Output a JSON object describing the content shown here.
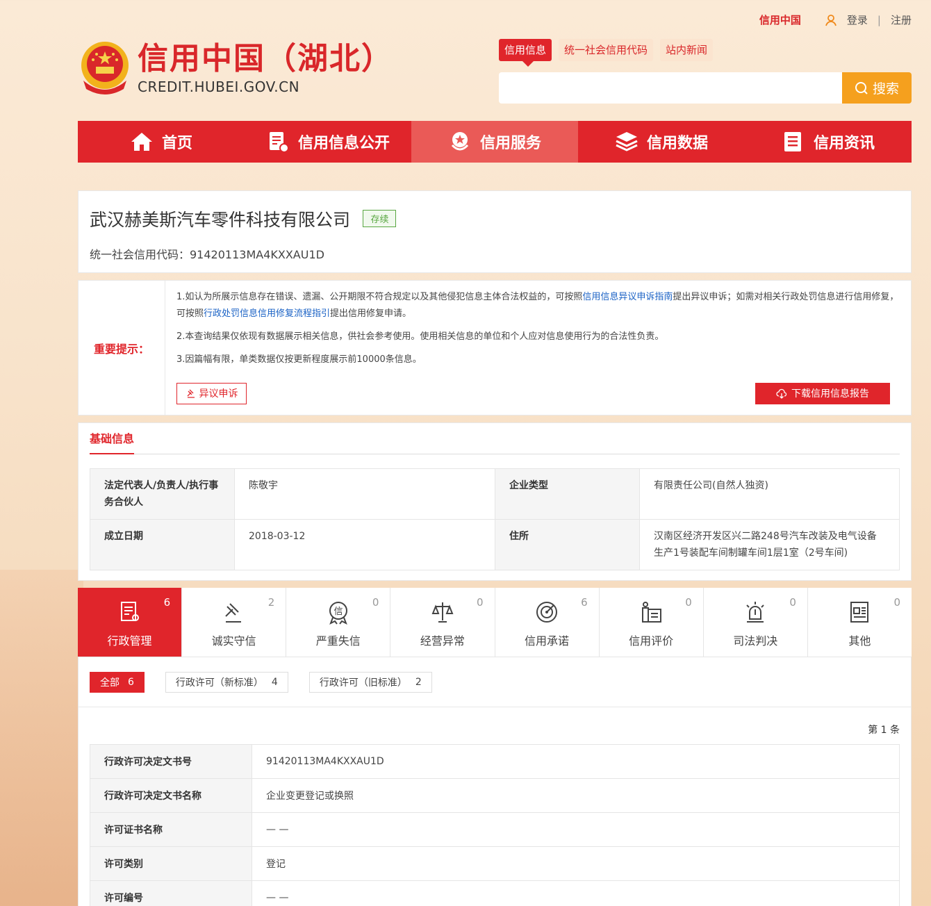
{
  "topbar": {
    "brand": "信用中国",
    "login": "登录",
    "separator": "|",
    "register": "注册"
  },
  "logo": {
    "title": "信用中国（湖北）",
    "subtitle": "CREDIT.HUBEI.GOV.CN"
  },
  "search": {
    "tabs": [
      {
        "label": "信用信息"
      },
      {
        "label": "统一社会信用代码"
      },
      {
        "label": "站内新闻"
      }
    ],
    "placeholder": "",
    "button_label": "搜索"
  },
  "nav": [
    {
      "label": "首页",
      "icon": "home-icon"
    },
    {
      "label": "信用信息公开",
      "icon": "document-badge-icon"
    },
    {
      "label": "信用服务",
      "icon": "service-medal-icon"
    },
    {
      "label": "信用数据",
      "icon": "layers-icon"
    },
    {
      "label": "信用资讯",
      "icon": "news-icon"
    }
  ],
  "company": {
    "name": "武汉赫美斯汽车零件科技有限公司",
    "status": "存续",
    "credit_code": "统一社会信用代码：91420113MA4KXXAU1D"
  },
  "notice": {
    "label": "重要提示：",
    "line1_a": "1.如认为所展示信息存在错误、遗漏、公开期限不符合规定以及其他侵犯信息主体合法权益的，可按照",
    "line1_link1": "信用信息异议申诉指南",
    "line1_b": "提出异议申诉；如需对相关行政处罚信息进行信用修复，可按照",
    "line1_link2": "行政处罚信息信用修复流程指引",
    "line1_c": "提出信用修复申请。",
    "line2": "2.本查询结果仅依现有数据展示相关信息，供社会参考使用。使用相关信息的单位和个人应对信息使用行为的合法性负责。",
    "line3": "3.因篇幅有限，单类数据仅按更新程度展示前10000条信息。",
    "objection_button": "异议申诉",
    "download_button": "下载信用信息报告"
  },
  "basic": {
    "title": "基础信息",
    "rows": [
      {
        "k1": "法定代表人/负责人/执行事务合伙人",
        "v1": "陈敬宇",
        "k2": "企业类型",
        "v2": "有限责任公司(自然人独资)"
      },
      {
        "k1": "成立日期",
        "v1": "2018-03-12",
        "k2": "住所",
        "v2": "汉南区经济开发区兴二路248号汽车改装及电气设备生产1号装配车间制罐车间1层1室（2号车间)"
      }
    ]
  },
  "categories": [
    {
      "label": "行政管理",
      "count": "6",
      "icon": "admin-doc-icon"
    },
    {
      "label": "诚实守信",
      "count": "2",
      "icon": "gavel-icon"
    },
    {
      "label": "严重失信",
      "count": "0",
      "icon": "credit-seal-icon"
    },
    {
      "label": "经营异常",
      "count": "0",
      "icon": "scales-icon"
    },
    {
      "label": "信用承诺",
      "count": "6",
      "icon": "target-icon"
    },
    {
      "label": "信用评价",
      "count": "0",
      "icon": "evaluation-icon"
    },
    {
      "label": "司法判决",
      "count": "0",
      "icon": "alarm-light-icon"
    },
    {
      "label": "其他",
      "count": "0",
      "icon": "other-doc-icon"
    }
  ],
  "filters": [
    {
      "label": "全部",
      "count": "6"
    },
    {
      "label": "行政许可（新标准）",
      "count": "4"
    },
    {
      "label": "行政许可（旧标准）",
      "count": "2"
    }
  ],
  "records": {
    "count_text": "第 1 条",
    "rows": [
      {
        "k": "行政许可决定文书号",
        "v": "91420113MA4KXXAU1D"
      },
      {
        "k": "行政许可决定文书名称",
        "v": "企业变更登记或换照"
      },
      {
        "k": "许可证书名称",
        "v": "— —"
      },
      {
        "k": "许可类别",
        "v": "登记"
      },
      {
        "k": "许可编号",
        "v": "— —"
      }
    ]
  },
  "colors": {
    "primary_red": "#e0252b",
    "nav_active": "#ea5a57",
    "search_orange": "#f5a01e",
    "status_green": "#58a640",
    "link_blue": "#1a62c5"
  }
}
